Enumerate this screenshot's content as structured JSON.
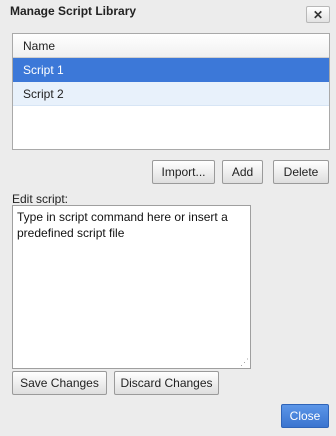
{
  "dialog": {
    "title": "Manage Script Library",
    "close_glyph": "✕"
  },
  "list": {
    "header": "Name",
    "items": [
      {
        "label": "Script 1",
        "selected": true
      },
      {
        "label": "Script 2",
        "selected": false
      }
    ]
  },
  "buttons": {
    "import": "Import...",
    "add": "Add",
    "delete": "Delete",
    "save_changes": "Save Changes",
    "discard_changes": "Discard Changes",
    "close": "Close"
  },
  "editor": {
    "label": "Edit script:",
    "value": "Type in script command here or insert a predefined script file"
  },
  "colors": {
    "selection": "#3c78d8",
    "primary_button": "#3a74cf"
  }
}
